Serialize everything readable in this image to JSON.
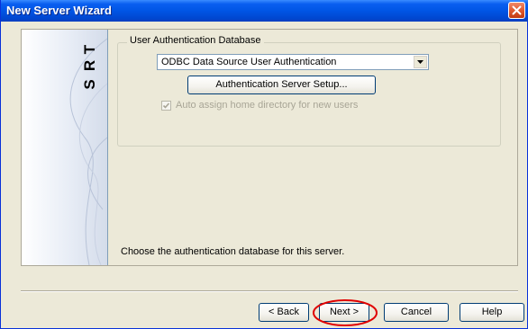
{
  "window": {
    "title": "New Server Wizard"
  },
  "side_panel": {
    "logo_letters": [
      "T",
      "R",
      "S"
    ]
  },
  "group": {
    "legend": "User Authentication Database",
    "database_select": {
      "selected": "ODBC Data Source User Authentication"
    },
    "auth_setup_button": "Authentication Server Setup...",
    "auto_assign_checkbox": {
      "label": "Auto assign home directory for new users",
      "checked": true,
      "enabled": false
    }
  },
  "description": "Choose the authentication database for this server.",
  "buttons": {
    "back": "< Back",
    "next": "Next >",
    "cancel": "Cancel",
    "help": "Help"
  },
  "colors": {
    "titlebar": "#0055e5",
    "highlight_ring": "#e00000",
    "dialog_bg": "#ece9d8"
  },
  "icons": {
    "close": "close-x-icon",
    "dropdown": "chevron-down-icon",
    "check": "checkmark-icon"
  }
}
